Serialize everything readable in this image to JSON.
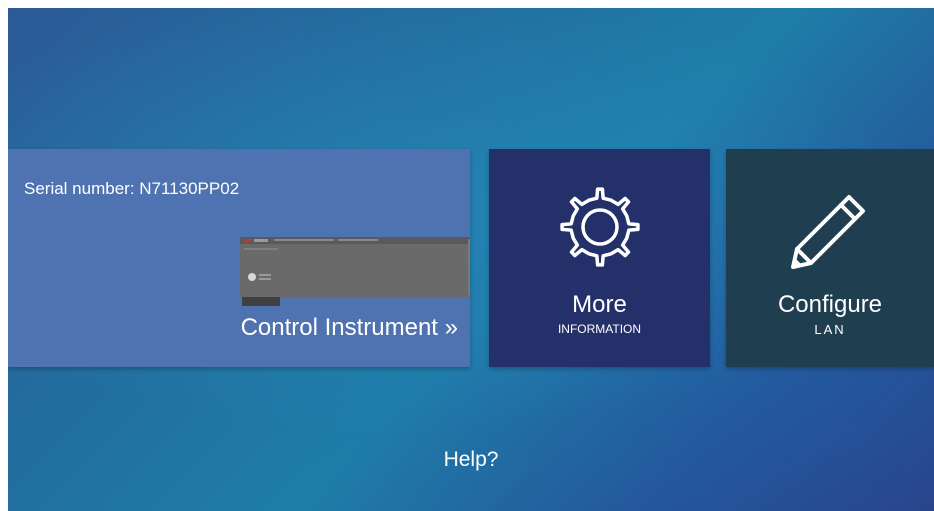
{
  "colors": {
    "control_tile": "#4f72b0",
    "more_tile": "#24306a",
    "configure_tile": "#1f3e4f",
    "text": "#ffffff"
  },
  "control_tile": {
    "serial_label": "Serial number: N71130PP02",
    "action_label": "Control Instrument »",
    "image": "instrument-front-panel"
  },
  "more_tile": {
    "icon": "gear-icon",
    "title": "More",
    "subtitle": "INFORMATION"
  },
  "configure_tile": {
    "icon": "pencil-icon",
    "title": "Configure",
    "subtitle": "LAN"
  },
  "help_link": "Help?"
}
